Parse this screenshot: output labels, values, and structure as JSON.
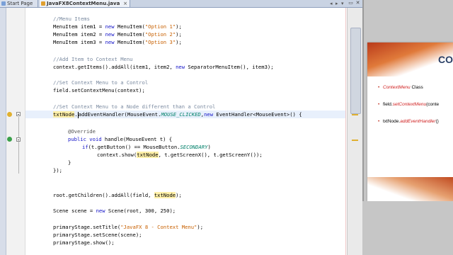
{
  "tabs": [
    {
      "label": "Start Page"
    },
    {
      "label": "JavaFX8ContextMenu.java"
    }
  ],
  "tab_nav": [
    "◂",
    "▸",
    "▾"
  ],
  "window_buttons": [
    "▭",
    "✕"
  ],
  "code": {
    "l1": "//Menu Items",
    "l2a": "MenuItem item1 = ",
    "l2b": "new",
    "l2c": " MenuItem(",
    "l2d": "\"Option 1\"",
    "l2e": ");",
    "l3a": "MenuItem item2 = ",
    "l3b": "new",
    "l3c": " MenuItem(",
    "l3d": "\"Option 2\"",
    "l3e": ");",
    "l4a": "MenuItem item3 = ",
    "l4b": "new",
    "l4c": " MenuItem(",
    "l4d": "\"Option 3\"",
    "l4e": ");",
    "l5": "//Add Item to Context Menu",
    "l6a": "context.getItems().addAll(item1, item2, ",
    "l6b": "new",
    "l6c": " SeparatorMenuItem(), item3);",
    "l7": "//Set Context Menu to a Control",
    "l8": "field.setContextMenu(context);",
    "l9": "//Set Context Menu to a Node different than a Control",
    "l10a": "txtNode",
    "l10b": ".",
    "l10c": "addEventHandler(MouseEvent.",
    "l10d": "MOUSE_CLICKED",
    "l10e": ",",
    "l10f": "new",
    "l10g": " EventHandler<MouseEvent>() {",
    "l11": "@Override",
    "l12a": "public",
    "l12b": " ",
    "l12c": "void",
    "l12d": " handle(MouseEvent t) {",
    "l13a": "if",
    "l13b": "(t.getButton() == MouseButton.",
    "l13c": "SECONDARY",
    "l13d": ")",
    "l14a": "context.show(",
    "l14b": "txtNode",
    "l14c": ", t.getScreenX(), t.getScreenY());",
    "l15": "}",
    "l16": "});",
    "l17a": "root.getChildren().addAll(field, ",
    "l17b": "txtNode",
    "l17c": ");",
    "l18a": "Scene scene = ",
    "l18b": "new",
    "l18c": " Scene(root, 300, 250);",
    "l19a": "primaryStage.setTitle(",
    "l19b": "\"JavaFX 8 - Context Menu\"",
    "l19c": ");",
    "l20": "primaryStage.setScene(scene);",
    "l21": "primaryStage.show();"
  },
  "slide": {
    "title": "CO",
    "b1_red": "ContextMenu",
    "b1_rest": " Class",
    "b2_a": "field.",
    "b2_red": "setContextMenu",
    "b2_rest": "(conte",
    "b3_a": "txtNode.",
    "b3_red": "addEventHandler",
    "b3_rest": "()"
  },
  "colors": {
    "comment": "#7a8aa0",
    "keyword": "#1414c8",
    "string": "#c86000",
    "constant": "#00806a",
    "highlight": "#fff0a8",
    "slide_title": "#2a3f66",
    "slide_accent": "#d02020"
  }
}
